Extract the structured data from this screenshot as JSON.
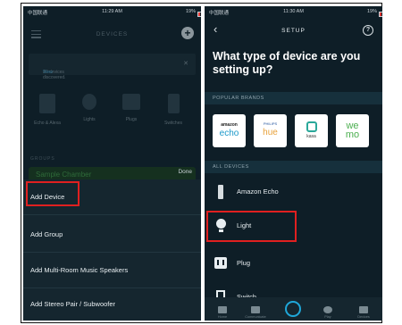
{
  "left": {
    "status": {
      "carrier": "中国联通",
      "time": "11:29 AM",
      "battery": "19%"
    },
    "header": {
      "title": "DEVICES"
    },
    "banner": {
      "text": "All devices discovered.",
      "link": "View"
    },
    "categories": [
      {
        "label": "Echo & Alexa"
      },
      {
        "label": "Lights"
      },
      {
        "label": "Plugs"
      },
      {
        "label": "Switches"
      }
    ],
    "groups_heading": "GROUPS",
    "group_name": "Sample Chamber",
    "sheet": {
      "done": "Done",
      "items": [
        {
          "label": "Add Device"
        },
        {
          "label": "Add Group"
        },
        {
          "label": "Add Multi-Room Music Speakers"
        },
        {
          "label": "Add Stereo Pair / Subwoofer"
        }
      ]
    }
  },
  "right": {
    "status": {
      "carrier": "中国联通",
      "time": "11:30 AM",
      "battery": "19%"
    },
    "header": {
      "title": "SETUP"
    },
    "question": "What type of device are you setting up?",
    "popular_heading": "POPULAR BRANDS",
    "brands": [
      {
        "top": "amazon",
        "name": "echo",
        "color": "#1a98c9"
      },
      {
        "top": "PHILIPS",
        "name": "hue",
        "color": "#e8a23c"
      },
      {
        "top": "",
        "name": "kasa",
        "color": "#2aa89a"
      },
      {
        "top": "",
        "name": "we mo",
        "color": "#4caf50"
      }
    ],
    "all_heading": "ALL DEVICES",
    "devices": [
      {
        "label": "Amazon Echo",
        "icon": "echo-speaker-icon"
      },
      {
        "label": "Light",
        "icon": "lightbulb-icon"
      },
      {
        "label": "Plug",
        "icon": "plug-icon"
      },
      {
        "label": "Switch",
        "icon": "switch-icon"
      }
    ],
    "tabs": [
      {
        "label": "Home"
      },
      {
        "label": "Communicate"
      },
      {
        "label": "Play"
      },
      {
        "label": "Devices"
      }
    ],
    "highlight_color": "#e02020"
  }
}
